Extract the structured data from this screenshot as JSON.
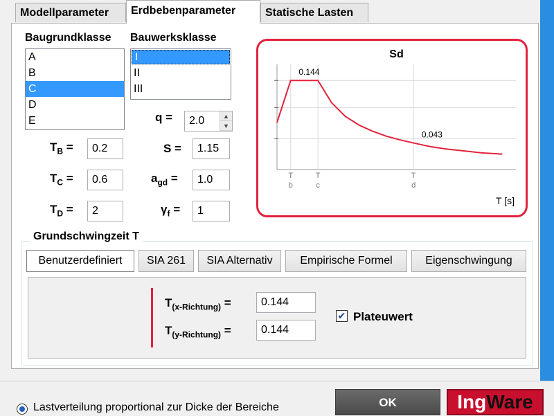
{
  "tabs": [
    {
      "label": "Modellparameter"
    },
    {
      "label": "Erdbebenparameter"
    },
    {
      "label": "Statische Lasten"
    }
  ],
  "baugrund": {
    "label": "Baugrundklasse",
    "items": [
      "A",
      "B",
      "C",
      "D",
      "E"
    ],
    "selected": "C"
  },
  "bauwerk": {
    "label": "Bauwerksklasse",
    "items": [
      "I",
      "II",
      "III"
    ],
    "selected": "I"
  },
  "params": {
    "tb": {
      "label": "T",
      "sub": "B",
      "eq": " =",
      "value": "0.2"
    },
    "tc": {
      "label": "T",
      "sub": "C",
      "eq": " =",
      "value": "0.6"
    },
    "td": {
      "label": "T",
      "sub": "D",
      "eq": " =",
      "value": "2"
    },
    "q": {
      "label": "q =",
      "value": "2.0"
    },
    "s": {
      "label": "S =",
      "value": "1.15"
    },
    "agd": {
      "label": "a",
      "sub": "gd",
      "eq": " =",
      "value": "1.0"
    },
    "gf": {
      "label": "γ",
      "sub": "f",
      "eq": " =",
      "value": "1"
    }
  },
  "chart_data": {
    "type": "line",
    "title": "Sd",
    "xlabel": "T [s]",
    "ylabel": "",
    "tick_labels": [
      {
        "top": "T",
        "sub": "b",
        "x": 0.2
      },
      {
        "top": "T",
        "sub": "c",
        "x": 0.6
      },
      {
        "top": "T",
        "sub": "d",
        "x": 2.0
      }
    ],
    "annotations": [
      {
        "text": "0.144",
        "x": 0.4,
        "y": 0.144
      },
      {
        "text": "0.043",
        "x": 2.2,
        "y": 0.043
      }
    ],
    "x": [
      0,
      0.2,
      0.6,
      0.8,
      1.0,
      1.2,
      1.4,
      1.6,
      1.8,
      2.0,
      2.25,
      2.5,
      2.75,
      3.0,
      3.3
    ],
    "y": [
      0.076,
      0.144,
      0.144,
      0.108,
      0.086,
      0.072,
      0.062,
      0.054,
      0.048,
      0.043,
      0.037,
      0.033,
      0.03,
      0.027,
      0.025
    ],
    "xlim": [
      0,
      3.5
    ],
    "ylim": [
      0,
      0.17
    ],
    "grid": true,
    "colors": {
      "line": "#e2223c",
      "frame": "#e2223c"
    }
  },
  "grundschwingzeit": {
    "title": "Grundschwingzeit T",
    "buttons": [
      "Benutzerdefiniert",
      "SIA 261",
      "SIA Alternativ",
      "Empirische Formel",
      "Eigenschwingung"
    ],
    "active": "Benutzerdefiniert",
    "tx": {
      "label": "T",
      "sub": "(x-Richtung)",
      "eq": " =",
      "value": "0.144"
    },
    "ty": {
      "label": "T",
      "sub": "(y-Richtung)",
      "eq": " =",
      "value": "0.144"
    },
    "plateau": {
      "label": "Plateuwert",
      "checked": true
    }
  },
  "bottom": {
    "radio_label": "Lastverteilung proportional zur Dicke der Bereiche",
    "ok_label": "OK",
    "logo_a": "Ing",
    "logo_b": "Ware"
  }
}
